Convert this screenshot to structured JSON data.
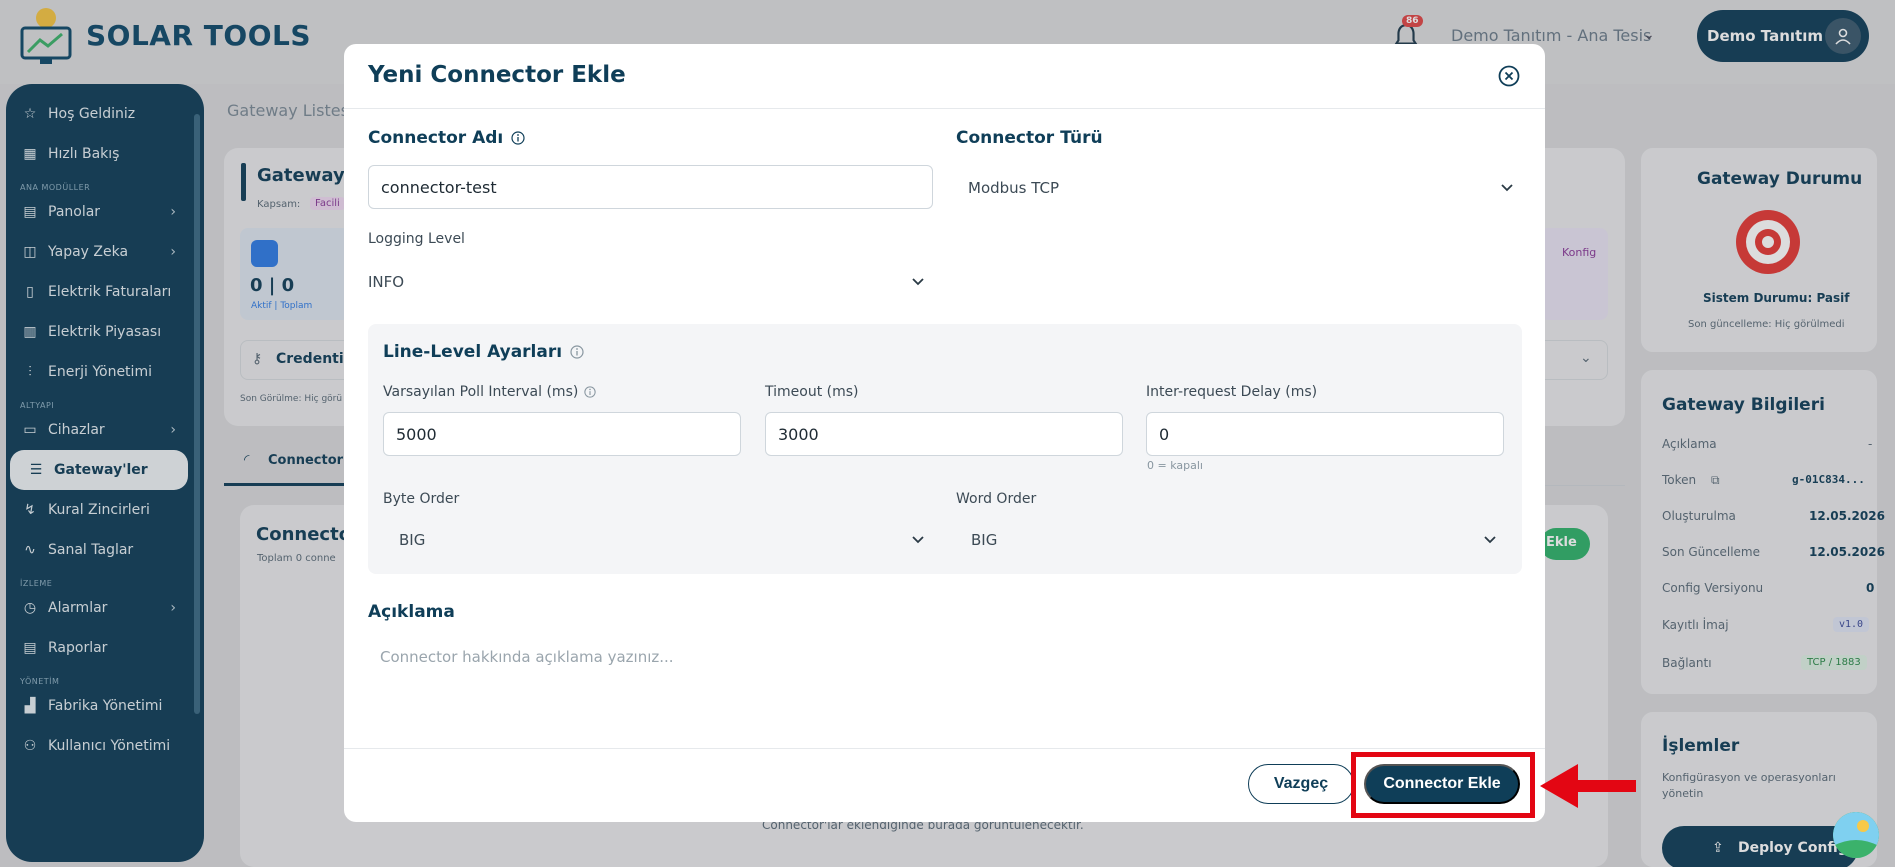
{
  "app": {
    "logo_text": "SOLAR TOOLS"
  },
  "topbar": {
    "notification_count": "86",
    "facility": "Demo Tanıtım - Ana Tesis",
    "user_name": "Demo Tanıtım"
  },
  "sidebar": {
    "items": [
      {
        "label": "Hoş Geldiniz",
        "icon": "star-icon"
      },
      {
        "label": "Hızlı Bakış",
        "icon": "grid-icon"
      },
      {
        "section": "ANA MODÜLLER"
      },
      {
        "label": "Panolar",
        "icon": "dashboard-icon",
        "has_children": true
      },
      {
        "label": "Yapay Zeka",
        "icon": "ai-icon",
        "has_children": true
      },
      {
        "label": "Elektrik Faturaları",
        "icon": "invoice-icon"
      },
      {
        "label": "Elektrik Piyasası",
        "icon": "market-icon"
      },
      {
        "label": "Enerji Yönetimi",
        "icon": "sliders-icon"
      },
      {
        "section": "ALTYAPI"
      },
      {
        "label": "Cihazlar",
        "icon": "monitor-icon",
        "has_children": true
      },
      {
        "label": "Gateway'ler",
        "icon": "server-icon",
        "active": true
      },
      {
        "label": "Kural Zincirleri",
        "icon": "flow-icon"
      },
      {
        "label": "Sanal Taglar",
        "icon": "pulse-icon"
      },
      {
        "section": "İZLEME"
      },
      {
        "label": "Alarmlar",
        "icon": "alarm-icon",
        "has_children": true
      },
      {
        "label": "Raporlar",
        "icon": "report-icon"
      },
      {
        "section": "YÖNETİM"
      },
      {
        "label": "Fabrika Yönetimi",
        "icon": "factory-icon"
      },
      {
        "label": "Kullanıcı Yönetimi",
        "icon": "users-icon"
      }
    ]
  },
  "background": {
    "breadcrumb": "Gateway Listesi",
    "gateway_title": "GatewayT",
    "scope_label": "Kapsam:",
    "scope_badge": "Facili",
    "counts": "0 | 0",
    "counts_sub": "Aktif | Toplam",
    "credentials": "Credentials",
    "last_seen": "Son Görülme: Hiç görü",
    "konfig": "Konfig",
    "tab_connectors": "Connector'la",
    "connector_card_title": "Connector'",
    "connector_card_sub": "Toplam 0 conne",
    "add_badge": "Ekle",
    "empty_note": "Connector'lar eklendiğinde burada görüntülenecektir."
  },
  "gateway_status": {
    "title": "Gateway Durumu",
    "system_status": "Sistem Durumu: Pasif",
    "last_update": "Son güncelleme: Hiç görülmedi"
  },
  "gateway_info": {
    "title": "Gateway Bilgileri",
    "rows": [
      {
        "label": "Açıklama",
        "value": "-"
      },
      {
        "label": "Token",
        "value": "g-01C834..."
      },
      {
        "label": "Oluşturulma",
        "value": "12.05.2026"
      },
      {
        "label": "Son Güncelleme",
        "value": "12.05.2026"
      },
      {
        "label": "Config Versiyonu",
        "value": "0"
      },
      {
        "label": "Kayıtlı İmaj",
        "value": "v1.0"
      },
      {
        "label": "Bağlantı",
        "value": "TCP / 1883"
      }
    ]
  },
  "operations": {
    "title": "İşlemler",
    "desc": "Konfigürasyon ve operasyonları yönetin",
    "deploy": "Deploy Config"
  },
  "modal": {
    "title": "Yeni Connector Ekle",
    "connector_name_label": "Connector Adı",
    "connector_name_value": "connector-test",
    "connector_type_label": "Connector Türü",
    "connector_type_value": "Modbus TCP",
    "logging_level_label": "Logging Level",
    "logging_level_value": "INFO",
    "line_level_title": "Line-Level Ayarları",
    "poll_interval_label": "Varsayılan Poll Interval (ms)",
    "poll_interval_value": "5000",
    "timeout_label": "Timeout (ms)",
    "timeout_value": "3000",
    "delay_label": "Inter-request Delay (ms)",
    "delay_value": "0",
    "delay_hint": "0 = kapalı",
    "byte_order_label": "Byte Order",
    "byte_order_value": "BIG",
    "word_order_label": "Word Order",
    "word_order_value": "BIG",
    "description_label": "Açıklama",
    "description_placeholder": "Connector hakkında açıklama yazınız...",
    "cancel_label": "Vazgeç",
    "submit_label": "Connector Ekle"
  },
  "colors": {
    "brand": "#0f3e58",
    "highlight": "#e30613",
    "status_red": "#e53935"
  }
}
